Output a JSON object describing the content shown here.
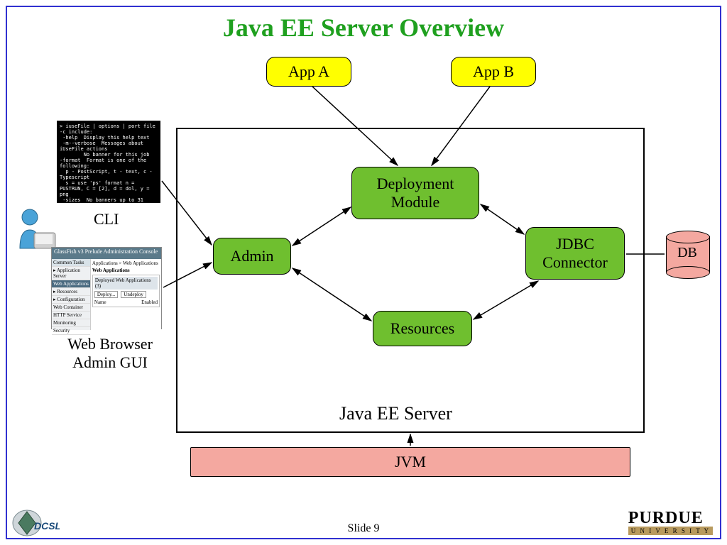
{
  "title": "Java EE Server Overview",
  "apps": {
    "a": "App A",
    "b": "App B"
  },
  "server": {
    "label": "Java EE Server",
    "admin": "Admin",
    "deployment": "Deployment\nModule",
    "resources": "Resources",
    "jdbc": "JDBC\nConnector"
  },
  "jvm": "JVM",
  "db": "DB",
  "clients": {
    "cli": "CLI",
    "gui": "Web Browser\nAdmin GUI"
  },
  "footer": {
    "slide": "Slide 9",
    "org_top": "PURDUE",
    "org_bottom": "U N I V E R S I T Y"
  }
}
